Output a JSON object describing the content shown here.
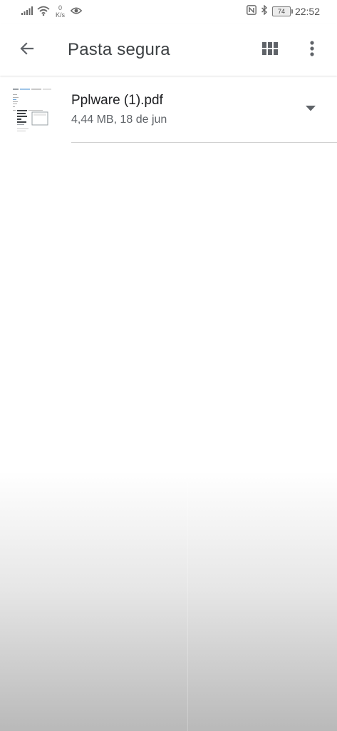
{
  "status_bar": {
    "net_speed_value": "0",
    "net_speed_unit": "K/s",
    "battery_level": "74",
    "time": "22:52",
    "icons": [
      "signal-icon",
      "wifi-icon",
      "eye-icon",
      "nfc-icon",
      "bluetooth-icon",
      "battery-icon"
    ]
  },
  "app_bar": {
    "title": "Pasta segura",
    "icons": [
      "back-arrow-icon",
      "grid-view-icon",
      "more-vert-icon"
    ]
  },
  "files": [
    {
      "name": "Pplware (1).pdf",
      "meta": "4,44 MB, 18 de jun",
      "icon": "pdf-thumbnail"
    }
  ],
  "colors": {
    "background": "#ffffff",
    "title_text": "#3c4043",
    "secondary_text": "#5f6368",
    "icon": "#5f6368"
  }
}
